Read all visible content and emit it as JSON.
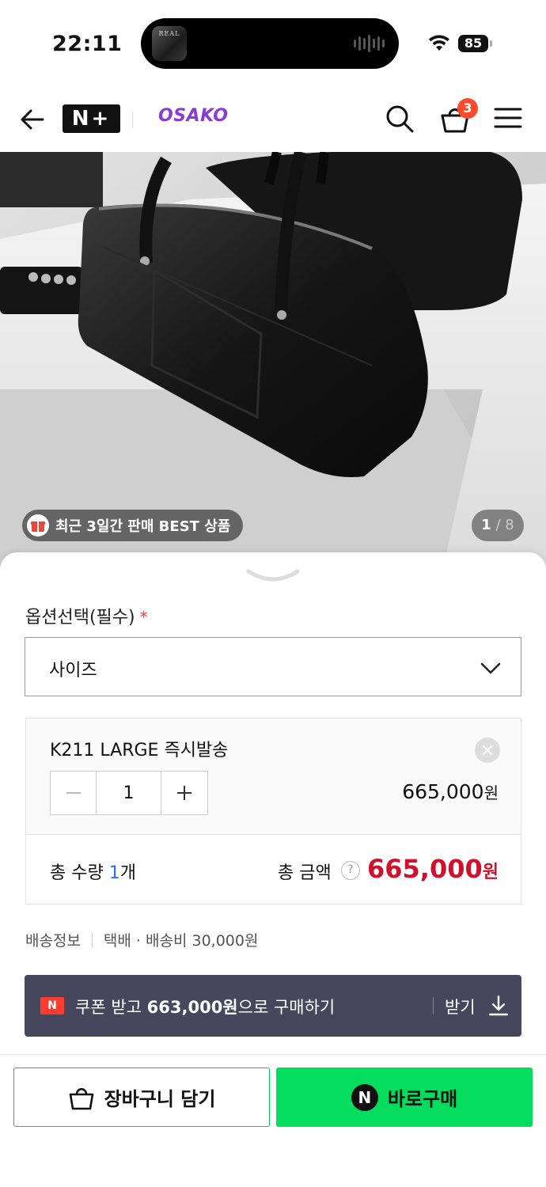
{
  "status_bar": {
    "time": "22:11",
    "battery": "85",
    "now_playing_art_text": "REAL"
  },
  "header": {
    "logo": "N+",
    "brand": "OSAKO",
    "cart_count": "3"
  },
  "gallery": {
    "badge": "최근 3일간 판매 BEST 상품",
    "current": "1",
    "total": "8"
  },
  "options": {
    "title": "옵션선택(필수)",
    "required_mark": "*",
    "select_value": "사이즈"
  },
  "selected_item": {
    "name": "K211 LARGE 즉시발송",
    "quantity": "1",
    "price": "665,000",
    "price_unit": "원"
  },
  "summary": {
    "qty_prefix": "총 수량",
    "qty_value": "1",
    "qty_unit": "개",
    "total_label": "총 금액",
    "help": "?",
    "total_price": "665,000",
    "total_unit": "원"
  },
  "shipping": {
    "label": "배송정보",
    "detail": "택배 · 배송비 30,000원"
  },
  "coupon": {
    "badge": "N",
    "text_prefix": "쿠폰 받고",
    "amount": "663,000원",
    "text_suffix": "으로 구매하기",
    "get": "받기"
  },
  "actions": {
    "cart": "장바구니 담기",
    "buy": "바로구매",
    "buy_badge": "N"
  },
  "colors": {
    "brand": "#8a3bd6",
    "price_red": "#d0112b",
    "buy_green": "#03dc5c",
    "coupon_bg": "#46475c"
  }
}
